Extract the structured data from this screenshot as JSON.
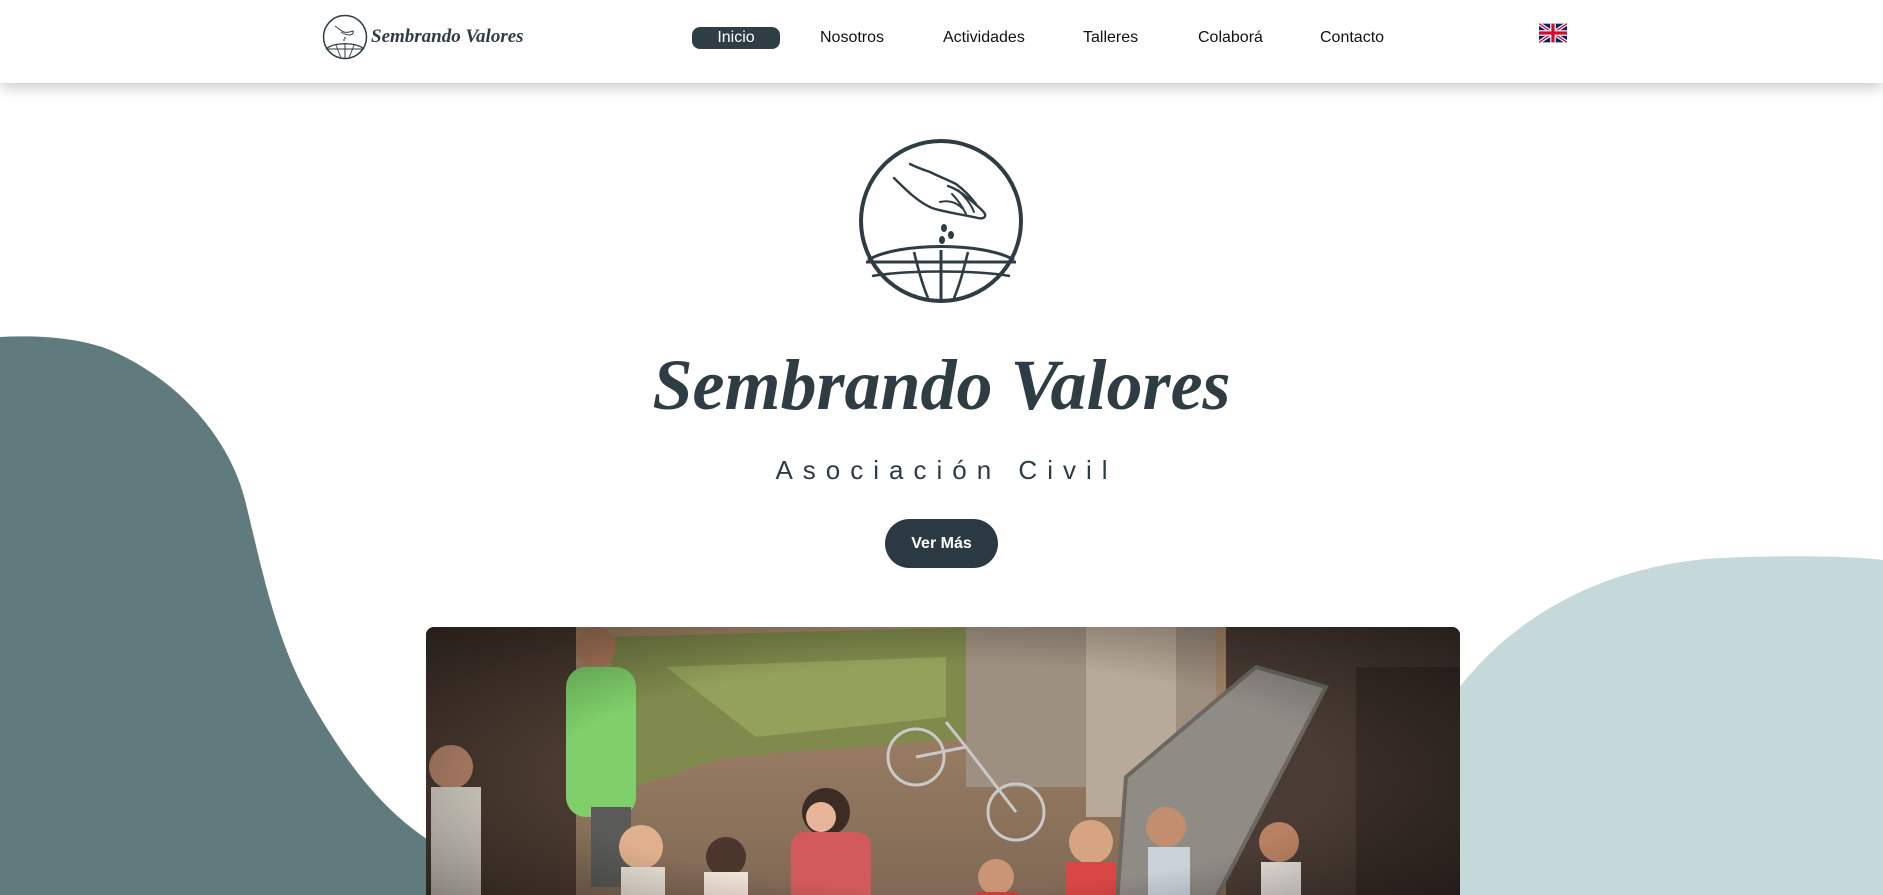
{
  "header": {
    "brand_name": "Sembrando Valores",
    "nav": [
      {
        "label": "Inicio",
        "active": true
      },
      {
        "label": "Nosotros",
        "active": false
      },
      {
        "label": "Actividades",
        "active": false
      },
      {
        "label": "Talleres",
        "active": false
      },
      {
        "label": "Colaborá",
        "active": false
      },
      {
        "label": "Contacto",
        "active": false
      }
    ],
    "language_icon": "uk-flag-icon"
  },
  "hero": {
    "logo_icon": "hand-sowing-seeds-globe-icon",
    "title": "Sembrando Valores",
    "subtitle": "Asociación Civil",
    "cta_label": "Ver Más",
    "photo_description_icon": "community-children-photo"
  },
  "colors": {
    "primary_dark": "#2e3c44",
    "blob_left": "#5f7b7e",
    "blob_right": "#c5d8da",
    "white": "#ffffff"
  }
}
